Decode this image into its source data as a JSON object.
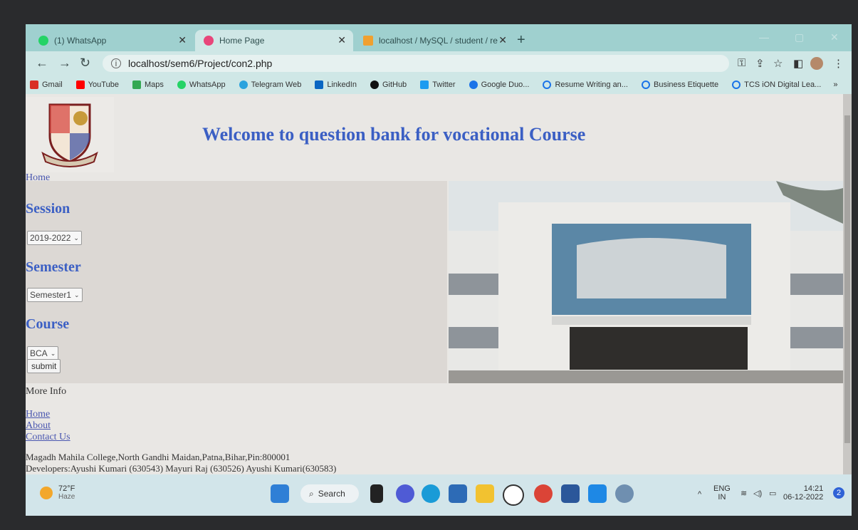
{
  "browser": {
    "tabs": [
      {
        "label": "(1) WhatsApp",
        "icon": "whatsapp-icon",
        "color": "#25d366"
      },
      {
        "label": "Home Page",
        "icon": "page-icon",
        "color": "#e8457a"
      },
      {
        "label": "localhost / MySQL / student / re",
        "icon": "phpmyadmin-icon",
        "color": "#f0a030"
      }
    ],
    "url": "localhost/sem6/Project/con2.php",
    "bookmarks": [
      {
        "label": "Gmail",
        "color": "#d93025"
      },
      {
        "label": "YouTube",
        "color": "#ff0000"
      },
      {
        "label": "Maps",
        "color": "#34a853"
      },
      {
        "label": "WhatsApp",
        "color": "#25d366"
      },
      {
        "label": "Telegram Web",
        "color": "#2aa3de"
      },
      {
        "label": "LinkedIn",
        "color": "#0a66c2"
      },
      {
        "label": "GitHub",
        "color": "#111111"
      },
      {
        "label": "Twitter",
        "color": "#1d9bf0"
      },
      {
        "label": "Google Duo...",
        "color": "#1a73e8"
      },
      {
        "label": "Resume Writing an...",
        "color": "#1a73e8"
      },
      {
        "label": "Business Etiquette",
        "color": "#1a73e8"
      },
      {
        "label": "TCS iON Digital Lea...",
        "color": "#1a73e8"
      }
    ]
  },
  "page": {
    "title": "Welcome to question bank for vocational Course",
    "nav_home": "Home",
    "session_label": "Session",
    "session_value": "2019-2022",
    "semester_label": "Semester",
    "semester_value": "Semester1",
    "course_label": "Course",
    "course_value": "BCA",
    "submit": "submit",
    "more_info": "More Info",
    "footer_links": [
      "Home",
      "About",
      "Contact Us"
    ],
    "address": "Magadh Mahila College,North Gandhi Maidan,Patna,Bihar,Pin:800001",
    "developers": "Developers:Ayushi Kumari (630543) Mayuri Raj (630526) Ayushi Kumari(630583)"
  },
  "taskbar": {
    "temperature": "72°F",
    "weather": "Haze",
    "search": "Search",
    "lang": "ENG",
    "region": "IN",
    "time": "14:21",
    "date": "06-12-2022",
    "notifications": "2"
  }
}
